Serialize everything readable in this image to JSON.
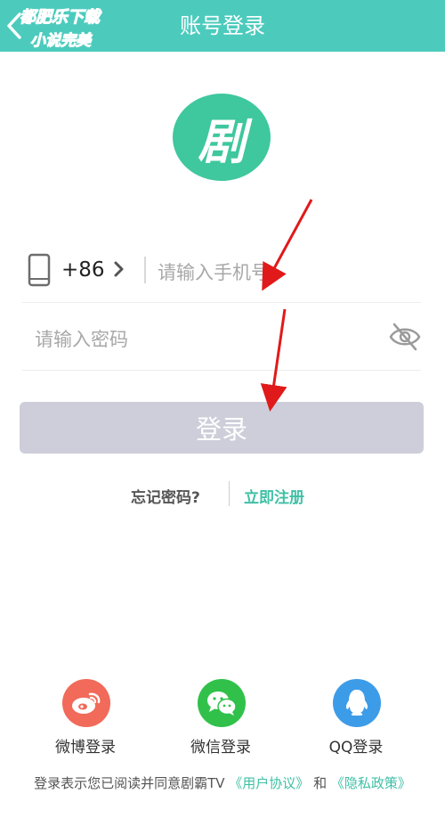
{
  "header": {
    "title": "账号登录",
    "back_icon": "chevron-left-icon",
    "watermark_line1": "都肥乐下载",
    "watermark_line2": "小说完美"
  },
  "logo": {
    "char": "剧",
    "color": "#3fc79e"
  },
  "phone": {
    "icon": "phone-icon",
    "country_code": "+86",
    "placeholder": "请输入手机号"
  },
  "password": {
    "placeholder": "请输入密码",
    "toggle_icon": "eye-slash-icon"
  },
  "login_button": {
    "label": "登录"
  },
  "links": {
    "forgot": "忘记密码?",
    "register": "立即注册"
  },
  "social": [
    {
      "name": "weibo",
      "label": "微博登录",
      "color": "#f16a5a",
      "icon": "weibo-icon"
    },
    {
      "name": "wechat",
      "label": "微信登录",
      "color": "#31c14b",
      "icon": "wechat-icon"
    },
    {
      "name": "qq",
      "label": "QQ登录",
      "color": "#3d9ce8",
      "icon": "qq-icon"
    }
  ],
  "terms": {
    "prefix": "登录表示您已阅读并同意剧霸TV",
    "agreement": "《用户协议》",
    "and": "和",
    "privacy": "《隐私政策》"
  },
  "colors": {
    "header": "#4ccbbd",
    "accent": "#3fc0a6",
    "button_disabled": "#cdced9",
    "annotation_arrow": "#e01a1a"
  }
}
